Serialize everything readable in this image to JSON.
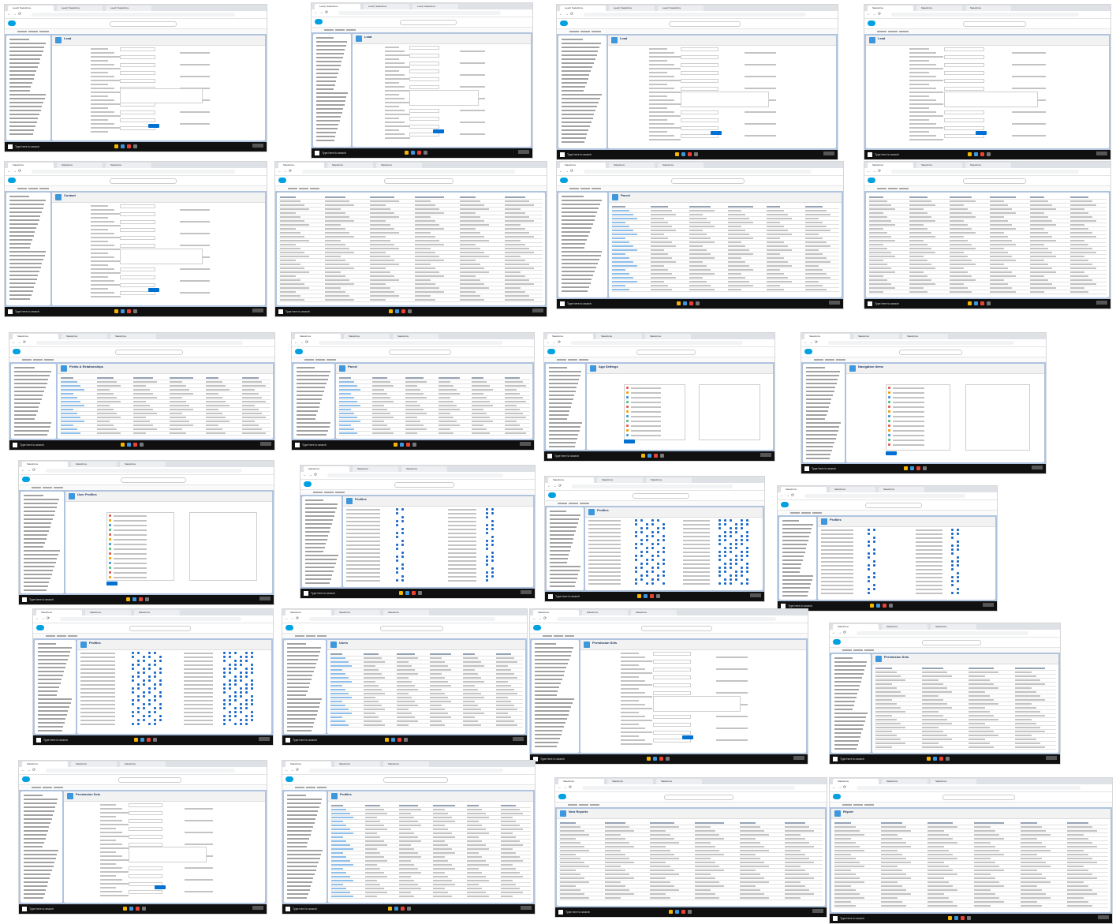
{
  "collage": {
    "taskbar_search": "Type here to search",
    "screens": [
      {
        "tab": "Lead | Salesforce",
        "title": "Lead",
        "kind": "form"
      },
      {
        "tab": "Lead | Salesforce",
        "title": "Lead",
        "kind": "form"
      },
      {
        "tab": "Lead | Salesforce",
        "title": "Lead",
        "kind": "form"
      },
      {
        "tab": "Salesforce",
        "title": "Lead",
        "kind": "form-wide"
      },
      {
        "tab": "Salesforce",
        "title": "Contact",
        "kind": "form"
      },
      {
        "tab": "Salesforce",
        "title": "",
        "kind": "table-wide"
      },
      {
        "tab": "Salesforce",
        "title": "Parcel",
        "kind": "fields"
      },
      {
        "tab": "Salesforce",
        "title": "",
        "kind": "table-wide"
      },
      {
        "tab": "Salesforce",
        "title": "Fields & Relationships",
        "kind": "fields"
      },
      {
        "tab": "Salesforce",
        "title": "Parcel",
        "kind": "fields"
      },
      {
        "tab": "Salesforce",
        "title": "App Settings",
        "kind": "app"
      },
      {
        "tab": "Salesforce",
        "title": "Navigation Items",
        "kind": "app-list"
      },
      {
        "tab": "Salesforce",
        "title": "User Profiles",
        "kind": "app-list"
      },
      {
        "tab": "Salesforce",
        "title": "Profiles",
        "kind": "profile"
      },
      {
        "tab": "Salesforce",
        "title": "Profiles",
        "kind": "profile-grid"
      },
      {
        "tab": "Salesforce",
        "title": "Profiles",
        "kind": "profile"
      },
      {
        "tab": "Salesforce",
        "title": "Profiles",
        "kind": "profile-grid"
      },
      {
        "tab": "Salesforce",
        "title": "Users",
        "kind": "users"
      },
      {
        "tab": "Salesforce",
        "title": "Permission Sets",
        "kind": "form"
      },
      {
        "tab": "Salesforce",
        "title": "Permission Sets",
        "kind": "table-narrow"
      },
      {
        "tab": "Salesforce",
        "title": "Permission Sets",
        "kind": "form"
      },
      {
        "tab": "Salesforce",
        "title": "Profiles",
        "kind": "users"
      },
      {
        "tab": "Salesforce",
        "title": "New Reports",
        "kind": "report"
      },
      {
        "tab": "Salesforce",
        "title": "Report",
        "kind": "report"
      }
    ]
  },
  "colors": {
    "salesforce_blue": "#00a1e0",
    "page_background": "#b0c4df",
    "brand_button": "#0070d2",
    "taskbar": "#101010"
  }
}
